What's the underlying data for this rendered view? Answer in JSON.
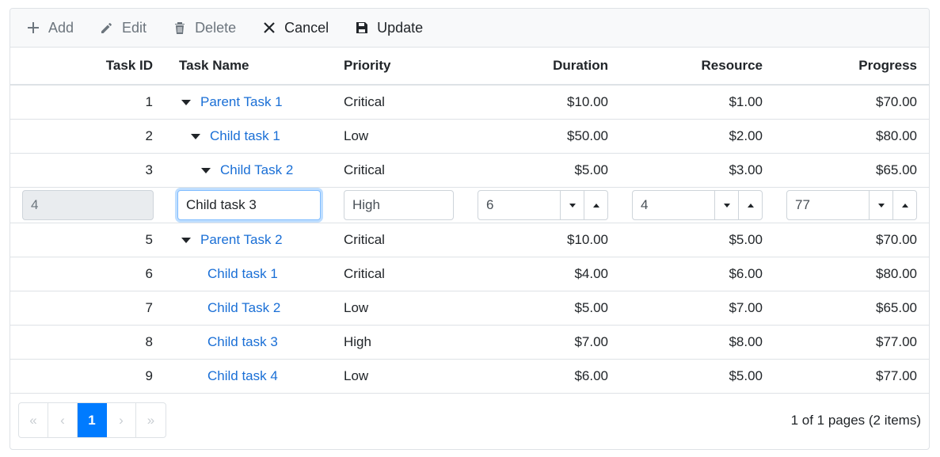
{
  "toolbar": {
    "add": "Add",
    "edit": "Edit",
    "delete": "Delete",
    "cancel": "Cancel",
    "update": "Update"
  },
  "columns": {
    "id": "Task ID",
    "name": "Task Name",
    "priority": "Priority",
    "duration": "Duration",
    "resource": "Resource",
    "progress": "Progress"
  },
  "rows": [
    {
      "id": "1",
      "name": "Parent Task 1",
      "priority": "Critical",
      "duration": "$10.00",
      "resource": "$1.00",
      "progress": "$70.00"
    },
    {
      "id": "2",
      "name": "Child task 1",
      "priority": "Low",
      "duration": "$50.00",
      "resource": "$2.00",
      "progress": "$80.00"
    },
    {
      "id": "3",
      "name": "Child Task 2",
      "priority": "Critical",
      "duration": "$5.00",
      "resource": "$3.00",
      "progress": "$65.00"
    },
    {
      "id": "5",
      "name": "Parent Task 2",
      "priority": "Critical",
      "duration": "$10.00",
      "resource": "$5.00",
      "progress": "$70.00"
    },
    {
      "id": "6",
      "name": "Child task 1",
      "priority": "Critical",
      "duration": "$4.00",
      "resource": "$6.00",
      "progress": "$80.00"
    },
    {
      "id": "7",
      "name": "Child Task 2",
      "priority": "Low",
      "duration": "$5.00",
      "resource": "$7.00",
      "progress": "$65.00"
    },
    {
      "id": "8",
      "name": "Child task 3",
      "priority": "High",
      "duration": "$7.00",
      "resource": "$8.00",
      "progress": "$77.00"
    },
    {
      "id": "9",
      "name": "Child task 4",
      "priority": "Low",
      "duration": "$6.00",
      "resource": "$5.00",
      "progress": "$77.00"
    }
  ],
  "edit_row": {
    "id": "4",
    "name": "Child task 3",
    "priority": "High",
    "duration": "6",
    "resource": "4",
    "progress": "77"
  },
  "pager": {
    "first": "«",
    "prev": "‹",
    "current": "1",
    "next": "›",
    "last": "»",
    "info": "1 of 1 pages (2 items)"
  },
  "colors": {
    "link": "#1a6fd6",
    "accent": "#007bff",
    "border": "#dee2e6"
  }
}
